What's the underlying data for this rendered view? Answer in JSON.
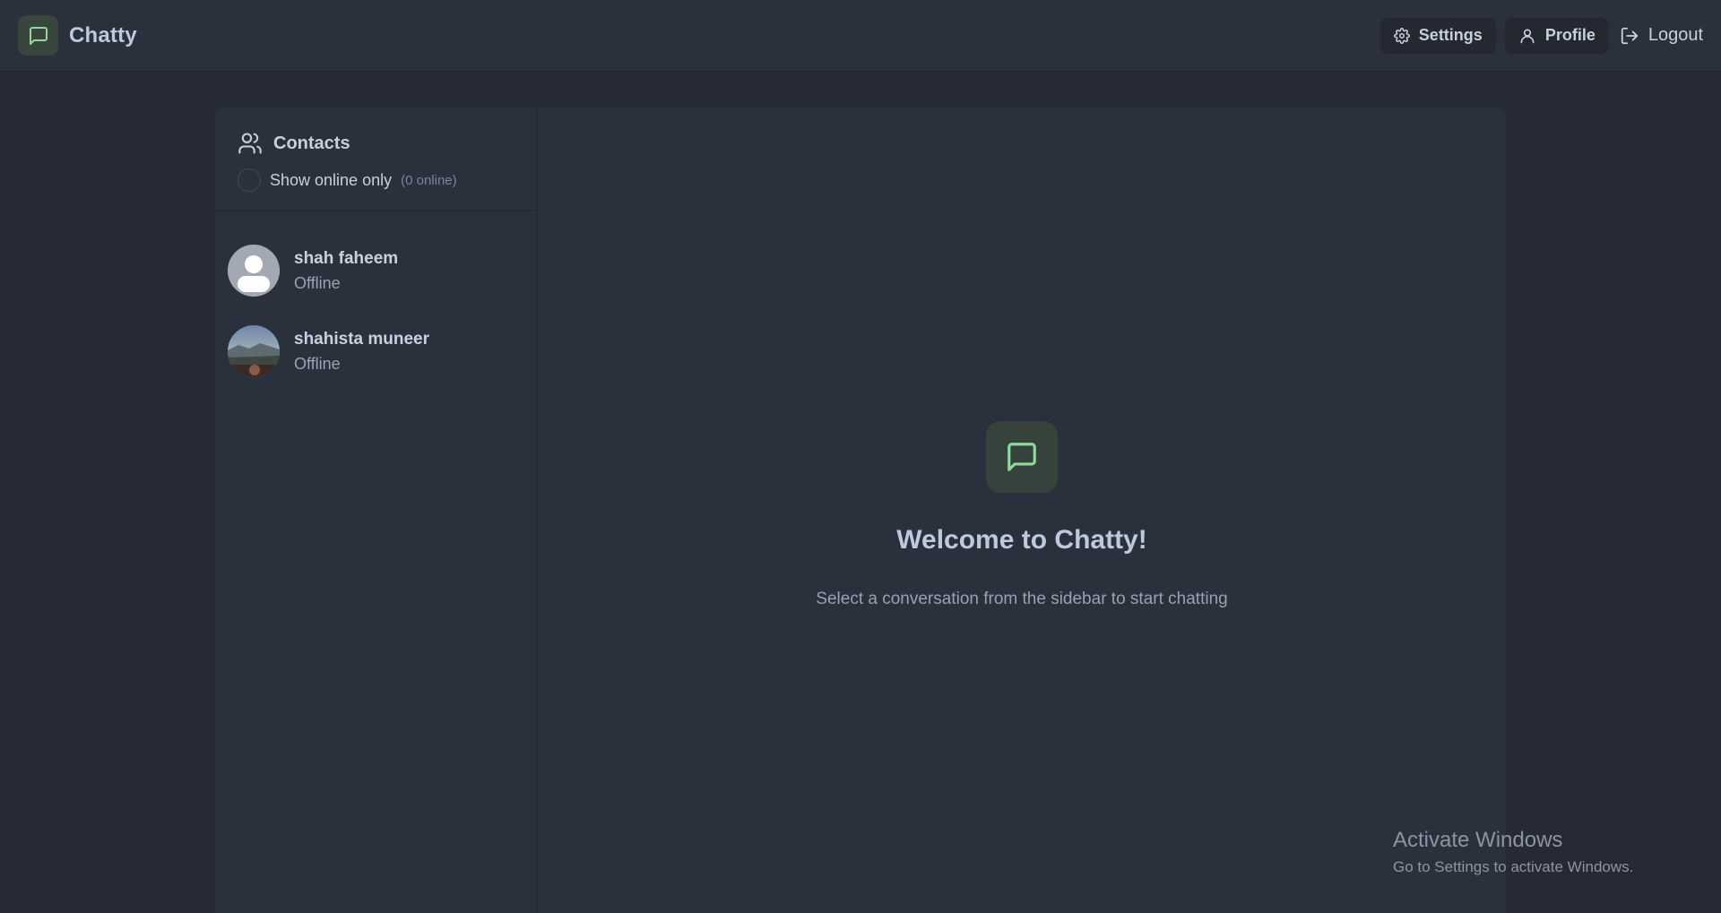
{
  "app": {
    "name": "Chatty",
    "accent_color": "#8fd99a",
    "logo_icon": "message-square-icon"
  },
  "nav": {
    "settings_label": "Settings",
    "settings_icon": "gear-icon",
    "profile_label": "Profile",
    "profile_icon": "user-icon",
    "logout_label": "Logout",
    "logout_icon": "logout-icon"
  },
  "sidebar": {
    "title": "Contacts",
    "title_icon": "users-icon",
    "filter_label": "Show online only",
    "online_count": "(0 online)",
    "contacts": [
      {
        "name": "shah faheem",
        "status": "Offline",
        "avatar": "default-avatar"
      },
      {
        "name": "shahista muneer",
        "status": "Offline",
        "avatar": "photo-avatar"
      }
    ]
  },
  "welcome": {
    "icon": "message-square-icon",
    "title": "Welcome to Chatty!",
    "subtitle": "Select a conversation from the sidebar to start chatting"
  },
  "watermark": {
    "title": "Activate Windows",
    "subtitle": "Go to Settings to activate Windows."
  }
}
